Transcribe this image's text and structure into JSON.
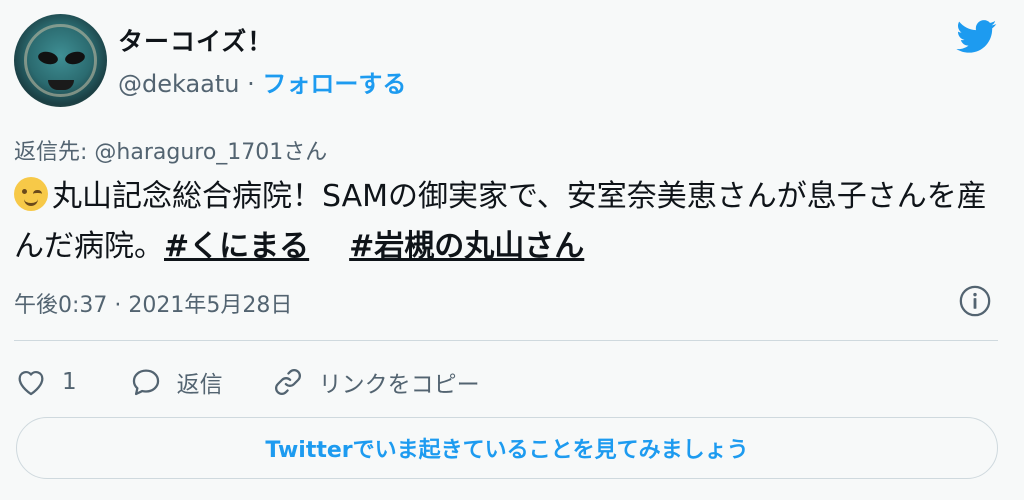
{
  "author": {
    "display_name": "ターコイズ！",
    "handle": "@dekaatu",
    "separator": " · ",
    "follow_label": "フォローする"
  },
  "reply_to": "返信先: @haraguro_1701さん",
  "tweet": {
    "emoji": "winking-face",
    "text_part1": "丸山記念総合病院！SAMの御実家で、安室奈美恵さんが息子さんを産んだ病院。",
    "hashtag1": "#くにまる",
    "hashtag2": "#岩槻の丸山さん"
  },
  "timestamp": "午後0:37 · 2021年5月28日",
  "actions": {
    "like_count": "1",
    "reply_label": "返信",
    "copy_link_label": "リンクをコピー"
  },
  "cta_label": "Twitterでいま起きていることを見てみましょう",
  "colors": {
    "accent": "#1d9bf0",
    "text": "#0f1419",
    "secondary": "#536471",
    "background": "#f7f9f9"
  },
  "icons": [
    "twitter-bird-icon",
    "info-icon",
    "heart-icon",
    "reply-bubble-icon",
    "link-icon"
  ]
}
